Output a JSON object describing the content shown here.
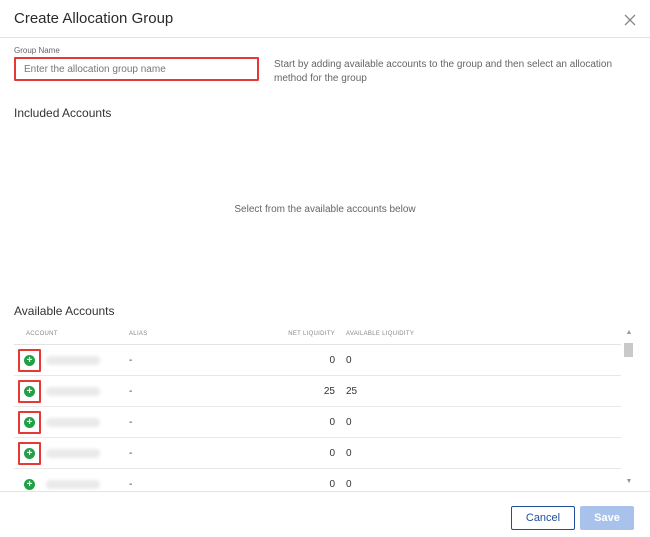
{
  "dialog": {
    "title": "Create Allocation Group",
    "close_icon": "close-icon"
  },
  "group_name": {
    "label": "Group Name",
    "placeholder": "Enter the allocation group name",
    "value": ""
  },
  "help_text": "Start by adding available accounts to the group and then select an allocation method for the group",
  "included": {
    "title": "Included Accounts",
    "empty_message": "Select from the available accounts below"
  },
  "available": {
    "title": "Available Accounts",
    "columns": {
      "account": "ACCOUNT",
      "alias": "ALIAS",
      "net_liquidity": "NET LIQUIDITY",
      "available_liquidity": "AVAILABLE LIQUIDITY"
    },
    "rows": [
      {
        "alias": "-",
        "net_liquidity": "0",
        "available_liquidity": "0"
      },
      {
        "alias": "-",
        "net_liquidity": "25",
        "available_liquidity": "25"
      },
      {
        "alias": "-",
        "net_liquidity": "0",
        "available_liquidity": "0"
      },
      {
        "alias": "-",
        "net_liquidity": "0",
        "available_liquidity": "0"
      },
      {
        "alias": "-",
        "net_liquidity": "0",
        "available_liquidity": "0"
      }
    ],
    "add_icon": "plus-circle-icon",
    "accent_color": "#22a046",
    "highlight_color": "#e53935"
  },
  "footer": {
    "cancel_label": "Cancel",
    "save_label": "Save"
  }
}
